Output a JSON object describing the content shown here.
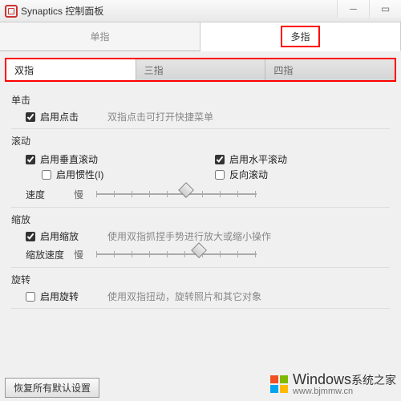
{
  "window": {
    "app_title": "Synaptics 控制面板"
  },
  "main_tabs": {
    "single": "单指",
    "multi": "多指",
    "active": "multi"
  },
  "sub_tabs": {
    "two": "双指",
    "three": "三指",
    "four": "四指",
    "active": "two"
  },
  "sections": {
    "click": {
      "title": "单击",
      "enable_click": {
        "label": "启用点击",
        "checked": true
      },
      "desc": "双指点击可打开快捷菜单"
    },
    "scroll": {
      "title": "滚动",
      "vertical": {
        "label": "启用垂直滚动",
        "checked": true
      },
      "horizontal": {
        "label": "启用水平滚动",
        "checked": true
      },
      "inertia": {
        "label": "启用惯性(I)",
        "checked": false
      },
      "reverse": {
        "label": "反向滚动",
        "checked": false
      },
      "speed_label": "速度",
      "slow": "慢"
    },
    "zoom": {
      "title": "缩放",
      "enable_zoom": {
        "label": "启用缩放",
        "checked": true
      },
      "desc": "使用双指抓捏手势进行放大或缩小操作",
      "speed_label": "缩放速度",
      "slow": "慢"
    },
    "rotate": {
      "title": "旋转",
      "enable_rotate": {
        "label": "启用旋转",
        "checked": false
      },
      "desc": "使用双指扭动，旋转照片和其它对象"
    }
  },
  "footer": {
    "restore": "恢复所有默认设置"
  },
  "watermark": {
    "brand": "Windows",
    "sub": "系统之家",
    "url": "www.bjmmw.cn"
  }
}
